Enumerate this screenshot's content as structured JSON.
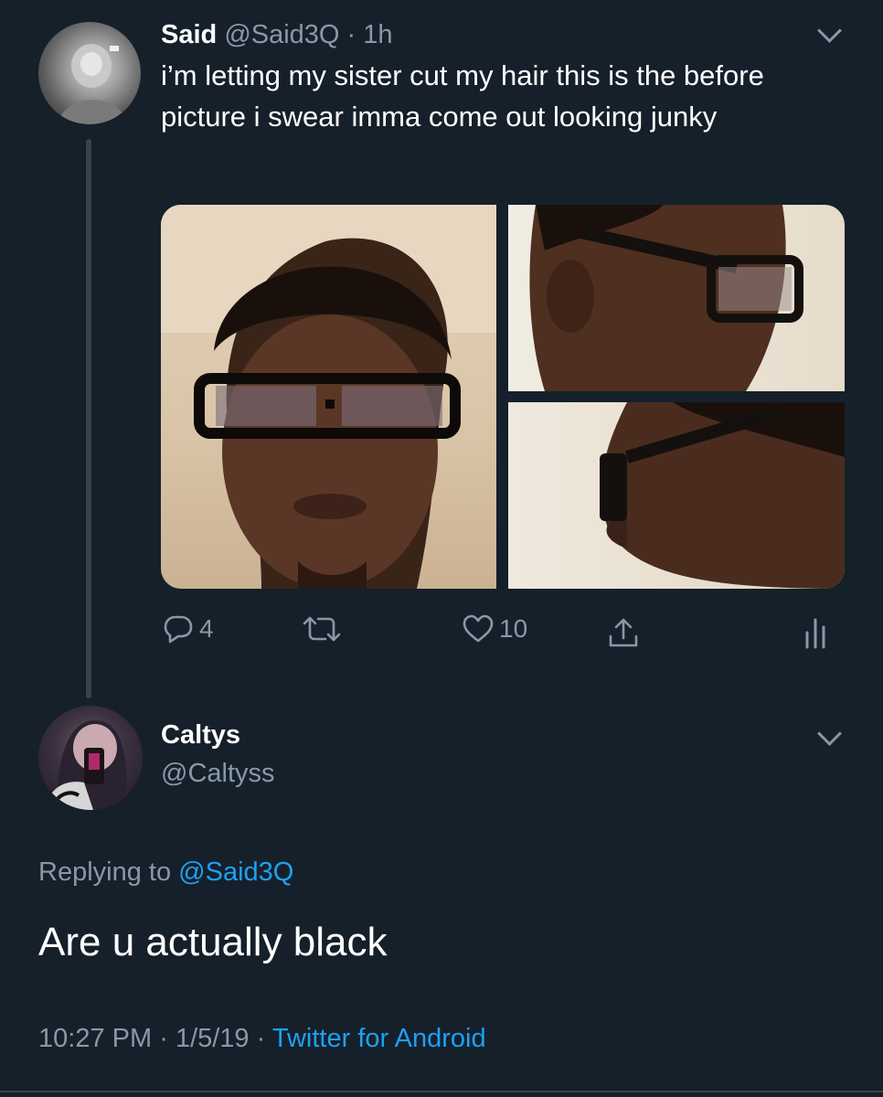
{
  "tweet": {
    "author_name": "Said",
    "author_handle": "@Said3Q",
    "separator": "·",
    "time": "1h",
    "text": "i’m letting my sister cut my hair this is the before picture i swear imma come out looking junky",
    "actions": {
      "reply_count": "4",
      "retweet_count": "",
      "like_count": "10"
    }
  },
  "reply": {
    "author_name": "Caltys",
    "author_handle": "@Caltyss",
    "replying_prefix": "Replying to",
    "replying_handle": "@Said3Q",
    "text": "Are u actually black",
    "time": "10:27 PM",
    "date": "1/5/19",
    "separator": "·",
    "source": "Twitter for Android"
  },
  "colors": {
    "background": "#15202b",
    "text": "#ffffff",
    "muted": "#8899a6",
    "link": "#1da1f2",
    "divider": "#38444d"
  },
  "icons": [
    "reply-icon",
    "retweet-icon",
    "like-icon",
    "share-icon",
    "analytics-icon",
    "chevron-down-icon"
  ]
}
